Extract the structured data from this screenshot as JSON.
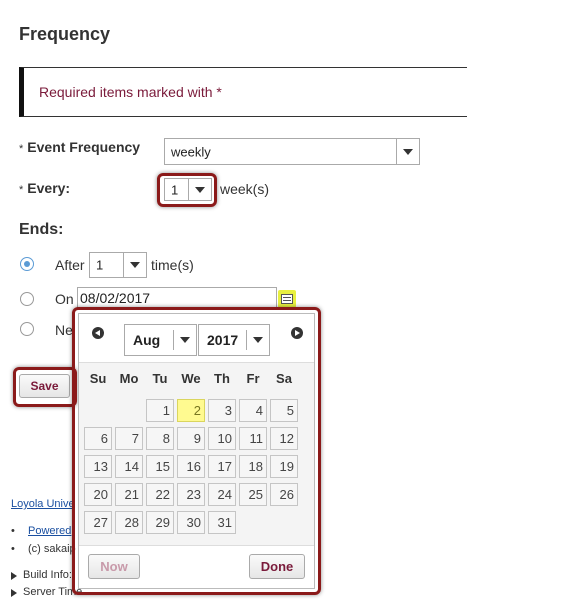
{
  "page": {
    "title": "Frequency"
  },
  "notice": {
    "text": "Required items marked with *"
  },
  "form": {
    "required_mark": "*",
    "event_frequency": {
      "label": "Event Frequency",
      "value": "weekly"
    },
    "every": {
      "label": "Every:",
      "value": "1",
      "suffix": "week(s)"
    },
    "ends": {
      "label": "Ends:",
      "after": {
        "label": "After",
        "value": "1",
        "suffix": "time(s)"
      },
      "on": {
        "label": "On",
        "value": "08/02/2017"
      },
      "never": {
        "label": "Ne"
      }
    },
    "save_label": "Save"
  },
  "footer": {
    "institution_link": "Loyola Unive",
    "powered_link": "Powered",
    "copyright": "(c) sakaip",
    "build_info": "Build Info:",
    "server_time": "Server Time"
  },
  "datepicker": {
    "month": "Aug",
    "year": "2017",
    "weekdays": [
      "Su",
      "Mo",
      "Tu",
      "We",
      "Th",
      "Fr",
      "Sa"
    ],
    "first_weekday_index": 2,
    "days": [
      "1",
      "2",
      "3",
      "4",
      "5",
      "6",
      "7",
      "8",
      "9",
      "10",
      "11",
      "12",
      "13",
      "14",
      "15",
      "16",
      "17",
      "18",
      "19",
      "20",
      "21",
      "22",
      "23",
      "24",
      "25",
      "26",
      "27",
      "28",
      "29",
      "30",
      "31"
    ],
    "today": "2",
    "now_label": "Now",
    "done_label": "Done"
  }
}
